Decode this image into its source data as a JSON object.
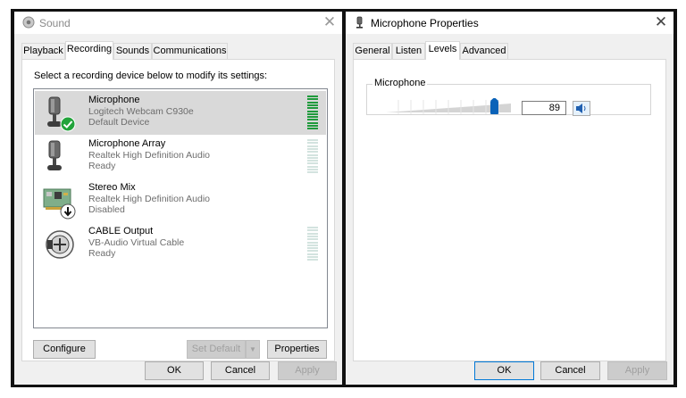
{
  "sound": {
    "title": "Sound",
    "tabs": [
      {
        "label": "Playback"
      },
      {
        "label": "Recording"
      },
      {
        "label": "Sounds"
      },
      {
        "label": "Communications"
      }
    ],
    "instruction": "Select a recording device below to modify its settings:",
    "devices": [
      {
        "name": "Microphone",
        "driver": "Logitech Webcam C930e",
        "status": "Default Device",
        "icon": "microphone-icon",
        "badge": "default-check",
        "level": 1.0
      },
      {
        "name": "Microphone Array",
        "driver": "Realtek High Definition Audio",
        "status": "Ready",
        "icon": "microphone-icon",
        "level": 0.0
      },
      {
        "name": "Stereo Mix",
        "driver": "Realtek High Definition Audio",
        "status": "Disabled",
        "icon": "sound-card-icon",
        "badge": "disabled-arrow"
      },
      {
        "name": "CABLE Output",
        "driver": "VB-Audio Virtual Cable",
        "status": "Ready",
        "icon": "cable-icon",
        "level": 0.0
      }
    ],
    "buttons": {
      "configure": "Configure",
      "set_default": "Set Default",
      "properties": "Properties",
      "ok": "OK",
      "cancel": "Cancel",
      "apply": "Apply"
    }
  },
  "props": {
    "title": "Microphone Properties",
    "tabs": [
      {
        "label": "General"
      },
      {
        "label": "Listen"
      },
      {
        "label": "Levels"
      },
      {
        "label": "Advanced"
      }
    ],
    "group_label": "Microphone",
    "level_value": "89",
    "level_fraction": 0.89,
    "buttons": {
      "ok": "OK",
      "cancel": "Cancel",
      "apply": "Apply"
    }
  },
  "colors": {
    "meter_active": "#1f9a3c",
    "meter_idle": "#d3e3df",
    "check_badge": "#22a33b",
    "slider_thumb": "#0a62b8",
    "accent_border": "#0078d7"
  }
}
